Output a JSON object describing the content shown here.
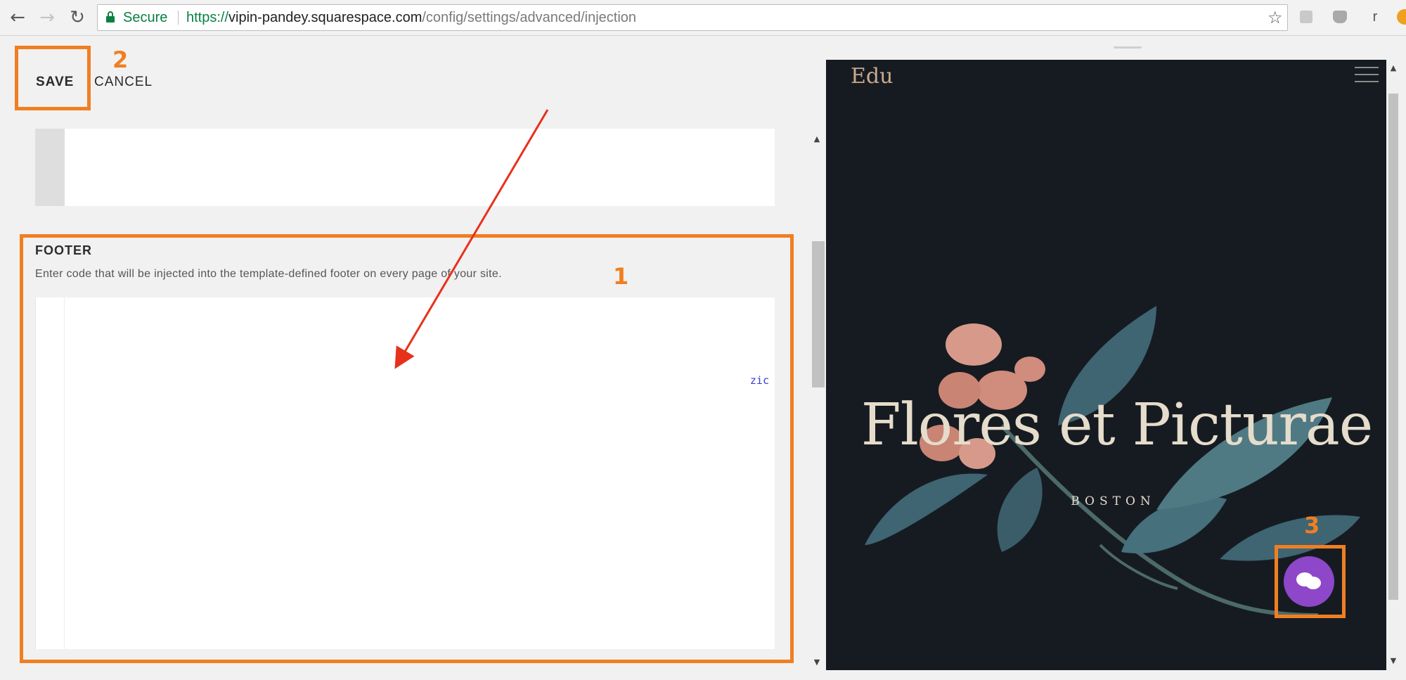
{
  "browser": {
    "secure_label": "Secure",
    "url_scheme": "https://",
    "url_host": "vipin-pandey.squarespace.com",
    "url_path": "/config/settings/advanced/injection",
    "extension_letter": "r"
  },
  "editor": {
    "save_label": "SAVE",
    "cancel_label": "CANCEL",
    "footer": {
      "title": "FOOTER",
      "description": "Enter code that will be injected into the template-defined footer on every page of your site.",
      "code_fragment": "zic"
    }
  },
  "annotations": {
    "step_1": "1",
    "step_2": "2",
    "step_3": "3",
    "highlight_color": "#f07f22",
    "arrow_color": "#e8311c"
  },
  "preview": {
    "logo": "Edu",
    "hero_title": "Flores et Picturae",
    "hero_subtitle": "BOSTON",
    "background_color": "#161b22",
    "chat_button_color": "#8e47c9"
  }
}
